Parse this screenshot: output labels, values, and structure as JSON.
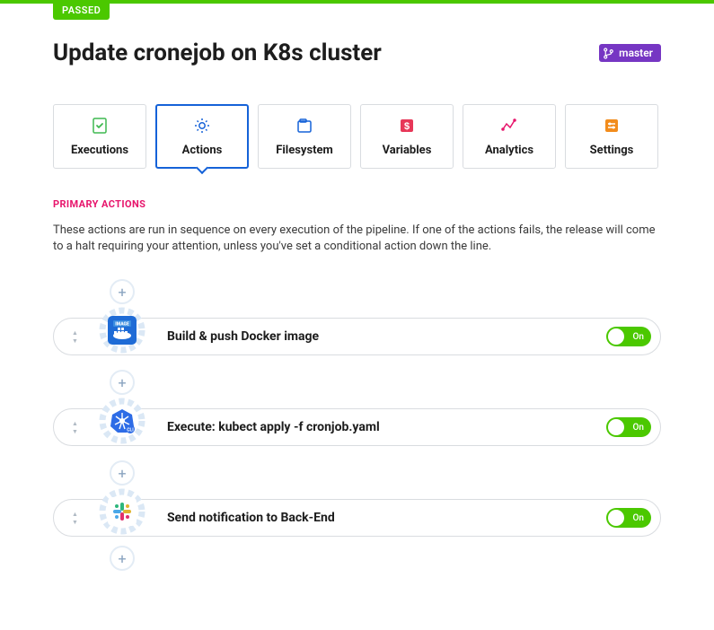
{
  "status_badge": "PASSED",
  "title": "Update cronejob on K8s cluster",
  "branch": "master",
  "tabs": [
    {
      "label": "Executions"
    },
    {
      "label": "Actions",
      "active": true
    },
    {
      "label": "Filesystem"
    },
    {
      "label": "Variables"
    },
    {
      "label": "Analytics"
    },
    {
      "label": "Settings"
    }
  ],
  "section": {
    "title": "PRIMARY ACTIONS",
    "description": "These actions are run in sequence on every execution of the pipeline. If one of the actions fails, the release will come to a halt requiring your attention, unless you've set a conditional action down the line."
  },
  "actions": [
    {
      "label": "Build & push Docker image",
      "toggle": "On",
      "icon": "docker"
    },
    {
      "label": "Execute: kubect apply -f cronjob.yaml",
      "toggle": "On",
      "icon": "kubernetes"
    },
    {
      "label": "Send notification to Back-End",
      "toggle": "On",
      "icon": "slack"
    }
  ]
}
